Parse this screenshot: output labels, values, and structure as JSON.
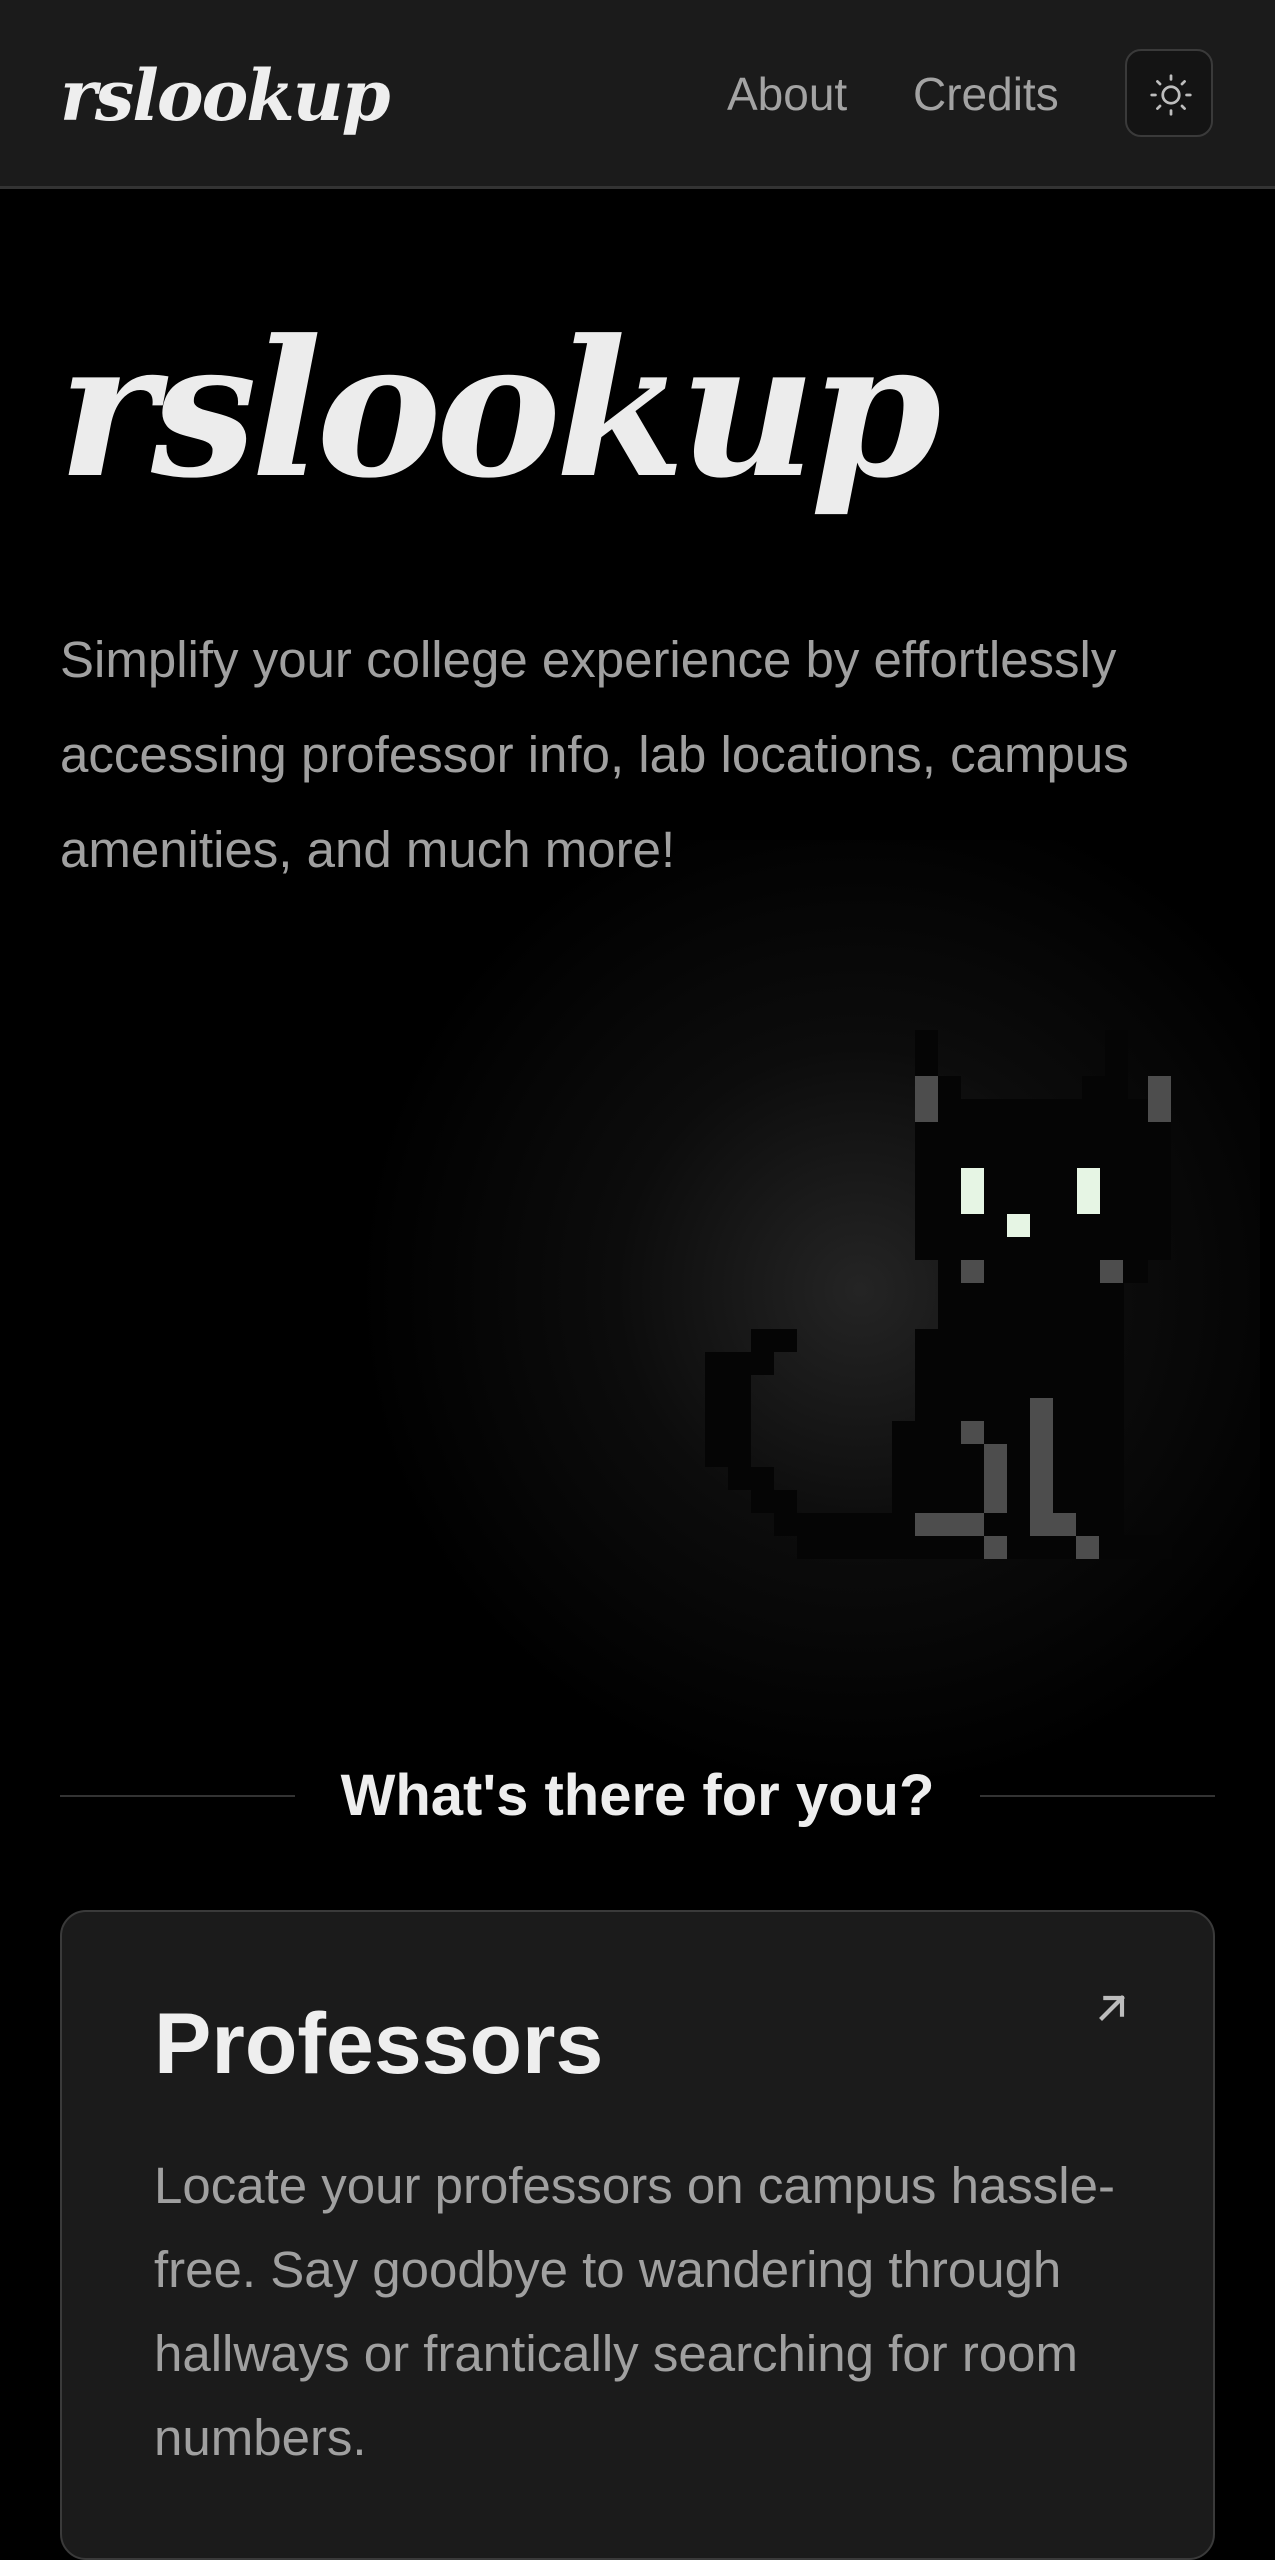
{
  "header": {
    "brand": "rslookup",
    "nav": {
      "about": "About",
      "credits": "Credits"
    },
    "theme_toggle_icon": "sun-icon"
  },
  "hero": {
    "title": "rslookup",
    "description": "Simplify your college experience by effortlessly accessing professor info, lab locations, campus amenities, and much more!",
    "illustration_icon": "pixel-cat-icon"
  },
  "features": {
    "heading": "What's there for you?",
    "cards": [
      {
        "title": "Professors",
        "description": "Locate your professors on campus hassle-free. Say goodbye to wandering through hallways or frantically searching for room numbers.",
        "icon": "arrow-up-right-icon"
      }
    ]
  },
  "colors": {
    "background": "#000000",
    "header_bg": "#1b1b1b",
    "card_bg": "#1b1b1b",
    "text_primary": "#eeeeee",
    "text_muted": "#a0a0a0",
    "cat_eyes": "#e6f5e4",
    "cat_detail": "#4d4d4d"
  }
}
